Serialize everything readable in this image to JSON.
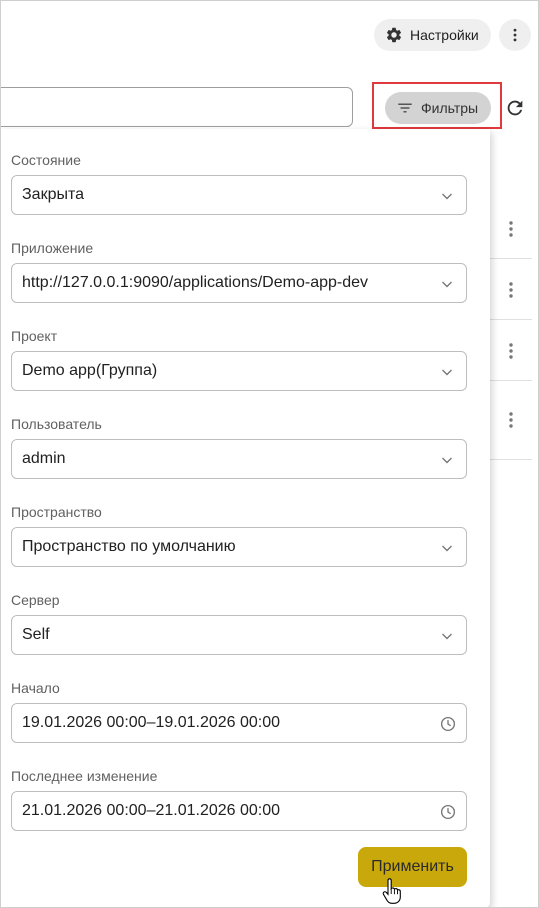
{
  "topbar": {
    "settings_label": "Настройки",
    "settings_icon": "gear-icon",
    "more_icon": "more-vert-icon"
  },
  "toolbar": {
    "search_value": "",
    "filter_label": "Фильтры",
    "filter_icon": "filter-list-icon",
    "refresh_icon": "refresh-icon",
    "highlight_color": "#e0393e"
  },
  "filters": {
    "state": {
      "label": "Состояние",
      "value": "Закрыта"
    },
    "application": {
      "label": "Приложение",
      "value": "http://127.0.0.1:9090/applications/Demo-app-dev"
    },
    "project": {
      "label": "Проект",
      "value": "Demo app(Группа)"
    },
    "user": {
      "label": "Пользователь",
      "value": "admin"
    },
    "space": {
      "label": "Пространство",
      "value": "Пространство по умолчанию"
    },
    "server": {
      "label": "Сервер",
      "value": "Self"
    },
    "start": {
      "label": "Начало",
      "value": "19.01.2026 00:00–19.01.2026 00:00"
    },
    "last_change": {
      "label": "Последнее изменение",
      "value": "21.01.2026 00:00–21.01.2026 00:00"
    },
    "apply_label": "Применить",
    "apply_color": "#c8a80a"
  }
}
